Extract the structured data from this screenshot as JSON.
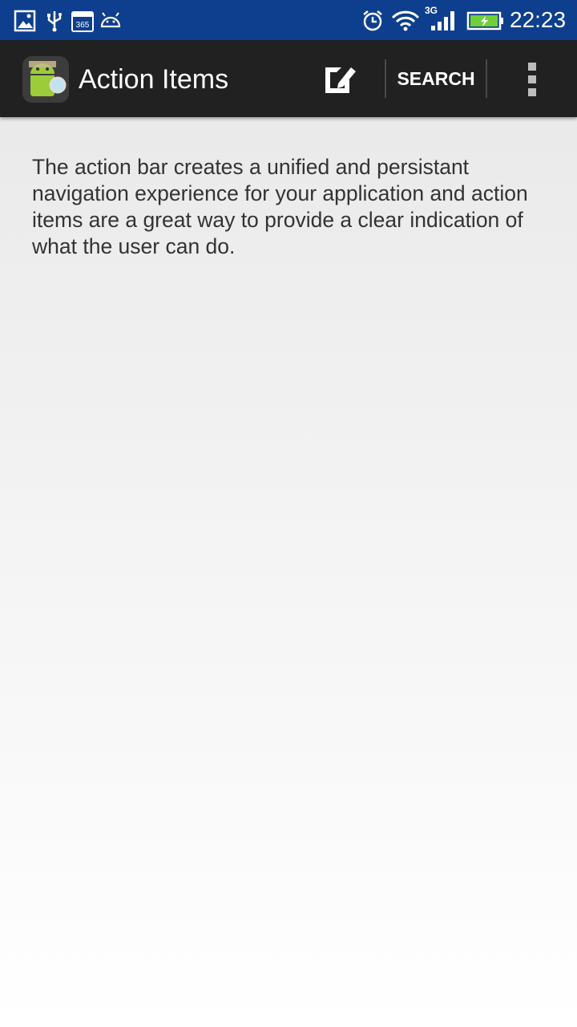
{
  "status_bar": {
    "icons": [
      "gallery-icon",
      "usb-icon",
      "calendar-365-icon",
      "android-icon",
      "alarm-icon",
      "wifi-icon",
      "signal-icon",
      "battery-icon"
    ],
    "calendar_text": "365",
    "network_type": "3G",
    "time": "22:23",
    "background_color": "#0e3f8e"
  },
  "action_bar": {
    "title": "Action Items",
    "compose_icon": "compose-icon",
    "search_label": "SEARCH",
    "overflow_icon": "overflow-menu-icon",
    "background_color": "#212121"
  },
  "content": {
    "description": "The action bar creates a unified and persistant navigation experience for your application and action items are a great way to provide a clear indication of what the user can do."
  }
}
